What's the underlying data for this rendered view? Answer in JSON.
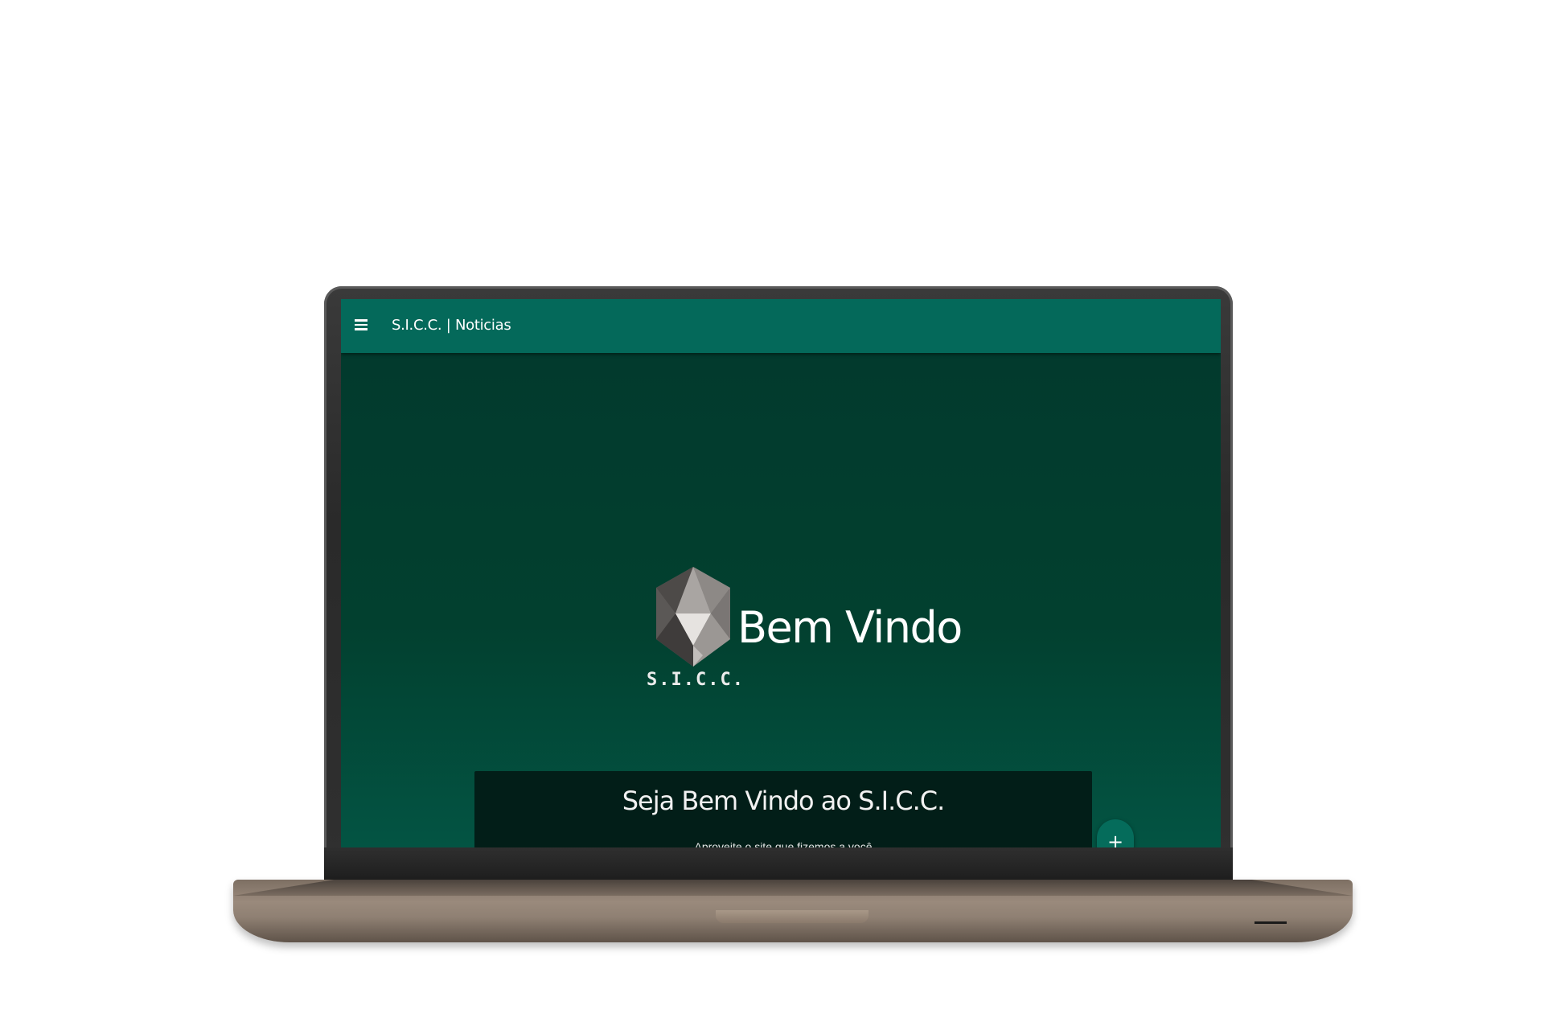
{
  "appbar": {
    "title": "S.I.C.C. | Noticias",
    "menu_icon": "hamburger-menu-icon",
    "color": "#04695a"
  },
  "hero": {
    "logo_text": "S.I.C.C.",
    "logo_icon": "crystal-gem-icon",
    "title": "Bem Vindo",
    "background": "#02402f"
  },
  "carousel": {
    "caption_title": "Seja Bem Vindo ao S.I.C.C.",
    "caption_subtitle": "Aproveite o site que fizemos a você",
    "indicator_count": 3,
    "active_indicator": 1
  },
  "fab": {
    "label": "+",
    "color": "#056c5b"
  }
}
